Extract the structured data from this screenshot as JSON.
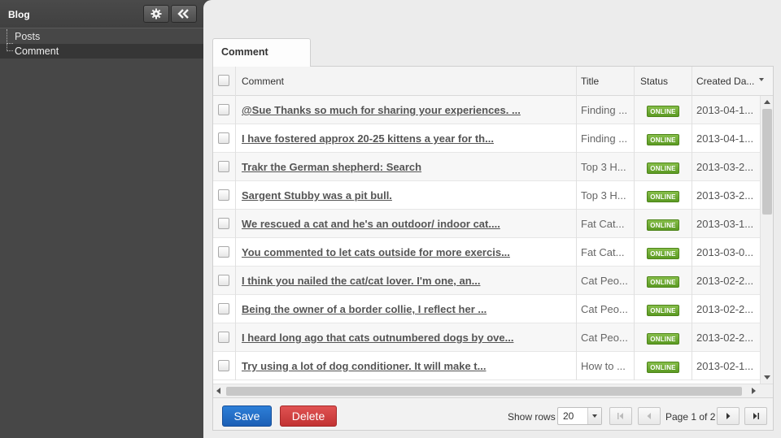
{
  "sidebar": {
    "title": "Blog",
    "items": [
      {
        "label": "Posts"
      },
      {
        "label": "Comment"
      }
    ]
  },
  "tab": {
    "label": "Comment"
  },
  "grid": {
    "columns": {
      "comment": "Comment",
      "title": "Title",
      "status": "Status",
      "created": "Created Da..."
    },
    "rows": [
      {
        "comment": "@Sue Thanks so much for sharing your experiences. ...",
        "title": "Finding ...",
        "status": "ONLINE",
        "created": "2013-04-1..."
      },
      {
        "comment": "I have fostered approx 20-25 kittens a year for th...",
        "title": "Finding ...",
        "status": "ONLINE",
        "created": "2013-04-1..."
      },
      {
        "comment": "Trakr the German shepherd: Search",
        "title": "Top 3 H...",
        "status": "ONLINE",
        "created": "2013-03-2..."
      },
      {
        "comment": "Sargent Stubby was a pit bull.",
        "title": "Top 3 H...",
        "status": "ONLINE",
        "created": "2013-03-2..."
      },
      {
        "comment": "We rescued a cat and he's an outdoor/ indoor cat....",
        "title": "Fat Cat...",
        "status": "ONLINE",
        "created": "2013-03-1..."
      },
      {
        "comment": "You commented to let cats outside for more exercis...",
        "title": "Fat Cat...",
        "status": "ONLINE",
        "created": "2013-03-0..."
      },
      {
        "comment": "I think you nailed the cat/cat lover. I'm one, an...",
        "title": "Cat Peo...",
        "status": "ONLINE",
        "created": "2013-02-2..."
      },
      {
        "comment": "Being the owner of a border collie, I reflect her ...",
        "title": "Cat Peo...",
        "status": "ONLINE",
        "created": "2013-02-2..."
      },
      {
        "comment": "I heard long ago that cats outnumbered dogs by ove...",
        "title": "Cat Peo...",
        "status": "ONLINE",
        "created": "2013-02-2..."
      },
      {
        "comment": "Try using a lot of dog conditioner. It will make t...",
        "title": "How to ...",
        "status": "ONLINE",
        "created": "2013-02-1..."
      }
    ]
  },
  "footer": {
    "save_label": "Save",
    "delete_label": "Delete",
    "show_rows_label": "Show rows",
    "rows_per_page": "20",
    "page_info": "Page 1 of 2"
  },
  "colors": {
    "sidebar_bg": "#474747",
    "status_online": "#6aa834",
    "save_button": "#2470c8",
    "delete_button": "#d04242"
  }
}
